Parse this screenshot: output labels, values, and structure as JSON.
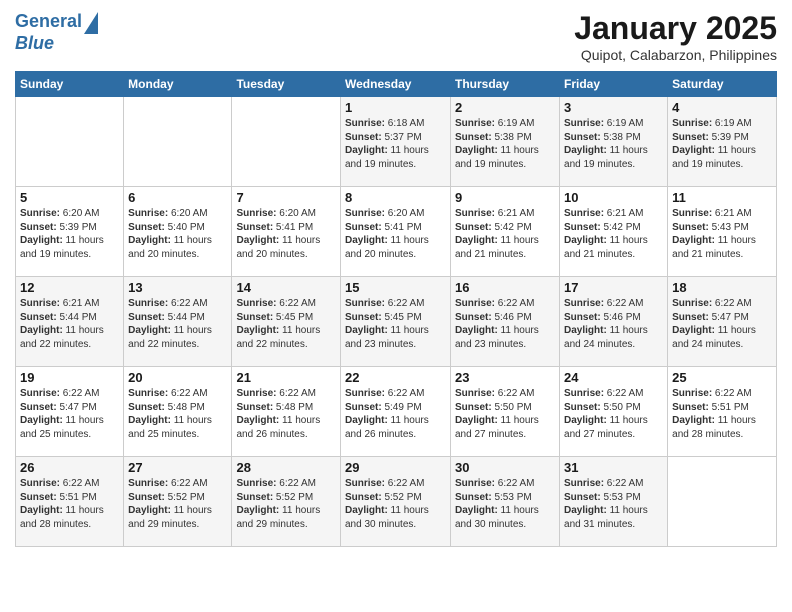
{
  "logo": {
    "line1": "General",
    "line2": "Blue"
  },
  "title": "January 2025",
  "subtitle": "Quipot, Calabarzon, Philippines",
  "days_of_week": [
    "Sunday",
    "Monday",
    "Tuesday",
    "Wednesday",
    "Thursday",
    "Friday",
    "Saturday"
  ],
  "weeks": [
    [
      {
        "day": "",
        "info": ""
      },
      {
        "day": "",
        "info": ""
      },
      {
        "day": "",
        "info": ""
      },
      {
        "day": "1",
        "info": "Sunrise: 6:18 AM\nSunset: 5:37 PM\nDaylight: 11 hours and 19 minutes."
      },
      {
        "day": "2",
        "info": "Sunrise: 6:19 AM\nSunset: 5:38 PM\nDaylight: 11 hours and 19 minutes."
      },
      {
        "day": "3",
        "info": "Sunrise: 6:19 AM\nSunset: 5:38 PM\nDaylight: 11 hours and 19 minutes."
      },
      {
        "day": "4",
        "info": "Sunrise: 6:19 AM\nSunset: 5:39 PM\nDaylight: 11 hours and 19 minutes."
      }
    ],
    [
      {
        "day": "5",
        "info": "Sunrise: 6:20 AM\nSunset: 5:39 PM\nDaylight: 11 hours and 19 minutes."
      },
      {
        "day": "6",
        "info": "Sunrise: 6:20 AM\nSunset: 5:40 PM\nDaylight: 11 hours and 20 minutes."
      },
      {
        "day": "7",
        "info": "Sunrise: 6:20 AM\nSunset: 5:41 PM\nDaylight: 11 hours and 20 minutes."
      },
      {
        "day": "8",
        "info": "Sunrise: 6:20 AM\nSunset: 5:41 PM\nDaylight: 11 hours and 20 minutes."
      },
      {
        "day": "9",
        "info": "Sunrise: 6:21 AM\nSunset: 5:42 PM\nDaylight: 11 hours and 21 minutes."
      },
      {
        "day": "10",
        "info": "Sunrise: 6:21 AM\nSunset: 5:42 PM\nDaylight: 11 hours and 21 minutes."
      },
      {
        "day": "11",
        "info": "Sunrise: 6:21 AM\nSunset: 5:43 PM\nDaylight: 11 hours and 21 minutes."
      }
    ],
    [
      {
        "day": "12",
        "info": "Sunrise: 6:21 AM\nSunset: 5:44 PM\nDaylight: 11 hours and 22 minutes."
      },
      {
        "day": "13",
        "info": "Sunrise: 6:22 AM\nSunset: 5:44 PM\nDaylight: 11 hours and 22 minutes."
      },
      {
        "day": "14",
        "info": "Sunrise: 6:22 AM\nSunset: 5:45 PM\nDaylight: 11 hours and 22 minutes."
      },
      {
        "day": "15",
        "info": "Sunrise: 6:22 AM\nSunset: 5:45 PM\nDaylight: 11 hours and 23 minutes."
      },
      {
        "day": "16",
        "info": "Sunrise: 6:22 AM\nSunset: 5:46 PM\nDaylight: 11 hours and 23 minutes."
      },
      {
        "day": "17",
        "info": "Sunrise: 6:22 AM\nSunset: 5:46 PM\nDaylight: 11 hours and 24 minutes."
      },
      {
        "day": "18",
        "info": "Sunrise: 6:22 AM\nSunset: 5:47 PM\nDaylight: 11 hours and 24 minutes."
      }
    ],
    [
      {
        "day": "19",
        "info": "Sunrise: 6:22 AM\nSunset: 5:47 PM\nDaylight: 11 hours and 25 minutes."
      },
      {
        "day": "20",
        "info": "Sunrise: 6:22 AM\nSunset: 5:48 PM\nDaylight: 11 hours and 25 minutes."
      },
      {
        "day": "21",
        "info": "Sunrise: 6:22 AM\nSunset: 5:48 PM\nDaylight: 11 hours and 26 minutes."
      },
      {
        "day": "22",
        "info": "Sunrise: 6:22 AM\nSunset: 5:49 PM\nDaylight: 11 hours and 26 minutes."
      },
      {
        "day": "23",
        "info": "Sunrise: 6:22 AM\nSunset: 5:50 PM\nDaylight: 11 hours and 27 minutes."
      },
      {
        "day": "24",
        "info": "Sunrise: 6:22 AM\nSunset: 5:50 PM\nDaylight: 11 hours and 27 minutes."
      },
      {
        "day": "25",
        "info": "Sunrise: 6:22 AM\nSunset: 5:51 PM\nDaylight: 11 hours and 28 minutes."
      }
    ],
    [
      {
        "day": "26",
        "info": "Sunrise: 6:22 AM\nSunset: 5:51 PM\nDaylight: 11 hours and 28 minutes."
      },
      {
        "day": "27",
        "info": "Sunrise: 6:22 AM\nSunset: 5:52 PM\nDaylight: 11 hours and 29 minutes."
      },
      {
        "day": "28",
        "info": "Sunrise: 6:22 AM\nSunset: 5:52 PM\nDaylight: 11 hours and 29 minutes."
      },
      {
        "day": "29",
        "info": "Sunrise: 6:22 AM\nSunset: 5:52 PM\nDaylight: 11 hours and 30 minutes."
      },
      {
        "day": "30",
        "info": "Sunrise: 6:22 AM\nSunset: 5:53 PM\nDaylight: 11 hours and 30 minutes."
      },
      {
        "day": "31",
        "info": "Sunrise: 6:22 AM\nSunset: 5:53 PM\nDaylight: 11 hours and 31 minutes."
      },
      {
        "day": "",
        "info": ""
      }
    ]
  ]
}
